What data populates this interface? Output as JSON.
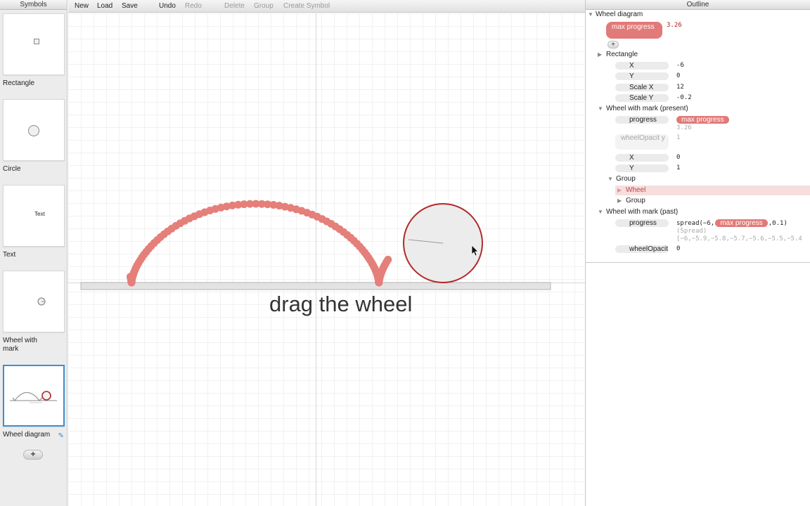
{
  "symbols_panel": {
    "title": "Symbols",
    "items": [
      {
        "label": "Rectangle"
      },
      {
        "label": "Circle"
      },
      {
        "label": "Text",
        "thumb_text": "Text"
      },
      {
        "label": "Wheel with mark"
      },
      {
        "label": "Wheel diagram",
        "selected": true
      }
    ],
    "add_label": "+"
  },
  "toolbar": {
    "new": "New",
    "load": "Load",
    "save": "Save",
    "undo": "Undo",
    "redo": "Redo",
    "delete": "Delete",
    "group": "Group",
    "create_symbol": "Create Symbol"
  },
  "canvas": {
    "caption": "drag the wheel",
    "colors": {
      "trail": "#e57f7a",
      "wheel_stroke": "#b22a2a",
      "wheel_fill": "#ececec",
      "ground": "#e3e3e3"
    }
  },
  "outline": {
    "title": "Outline",
    "root": "Wheel diagram",
    "max_progress_label": "max progress",
    "max_progress_value": "3.26",
    "add_label": "+",
    "rectangle": {
      "name": "Rectangle",
      "props": [
        {
          "name": "X",
          "value": "-6"
        },
        {
          "name": "Y",
          "value": "0"
        },
        {
          "name": "Scale X",
          "value": "12"
        },
        {
          "name": "Scale Y",
          "value": "-0.2"
        }
      ]
    },
    "present": {
      "name": "Wheel with mark (present)",
      "progress_label": "progress",
      "progress_ref": "max progress",
      "progress_eval": "3.26",
      "opacity_label": "wheelOpacit y",
      "opacity_value": "1",
      "x_label": "X",
      "x_value": "0",
      "y_label": "Y",
      "y_value": "1",
      "group": "Group",
      "wheel": "Wheel",
      "subgroup": "Group"
    },
    "past": {
      "name": "Wheel with mark (past)",
      "progress_label": "progress",
      "expr_prefix": "spread(−6,",
      "expr_ref": "max progress",
      "expr_suffix": ",0.1)",
      "spread_note": "(Spread)",
      "spread_values": "[−6,−5.9,−5.8,−5.7,−5.6,−5.5,−5.4",
      "opacity_label": "wheelOpacit",
      "opacity_value": "0"
    }
  }
}
